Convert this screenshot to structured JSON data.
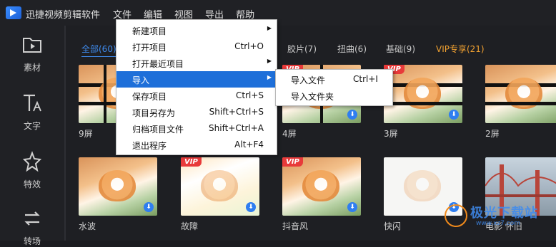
{
  "app": {
    "title": "迅捷视频剪辑软件"
  },
  "menubar": [
    "文件",
    "编辑",
    "视图",
    "导出",
    "帮助"
  ],
  "sidebar": [
    {
      "icon": "folder-icon",
      "label": "素材"
    },
    {
      "icon": "text-icon",
      "label": "文字"
    },
    {
      "icon": "sparkle-icon",
      "label": "特效"
    },
    {
      "icon": "transition-icon",
      "label": "转场"
    }
  ],
  "tabs": [
    {
      "label": "全部(60)",
      "active": true
    },
    {
      "label": "胶片(7)"
    },
    {
      "label": "扭曲(6)"
    },
    {
      "label": "基础(9)"
    },
    {
      "label": "VIP专享(21)",
      "vip": true
    }
  ],
  "file_menu": [
    {
      "label": "新建项目",
      "submenu": true
    },
    {
      "label": "打开项目",
      "shortcut": "Ctrl+O"
    },
    {
      "label": "打开最近项目",
      "submenu": true
    },
    {
      "label": "导入",
      "submenu": true,
      "highlighted": true
    },
    {
      "label": "保存项目",
      "shortcut": "Ctrl+S"
    },
    {
      "label": "项目另存为",
      "shortcut": "Shift+Ctrl+S"
    },
    {
      "label": "归档项目文件",
      "shortcut": "Shift+Ctrl+A"
    },
    {
      "label": "退出程序",
      "shortcut": "Alt+F4"
    }
  ],
  "import_submenu": [
    {
      "label": "导入文件",
      "shortcut": "Ctrl+I"
    },
    {
      "label": "导入文件夹"
    }
  ],
  "effects": [
    {
      "label": "9屏",
      "vip": false,
      "download": false
    },
    {
      "label": "",
      "vip": false,
      "download": false
    },
    {
      "label": "4屏",
      "vip": true,
      "download": true,
      "vip_text": "VIP"
    },
    {
      "label": "3屏",
      "vip": true,
      "download": true,
      "vip_text": "VIP"
    },
    {
      "label": "2屏",
      "vip": false,
      "download": false
    },
    {
      "label": "水波",
      "vip": false,
      "download": true
    },
    {
      "label": "故障",
      "vip": true,
      "download": true,
      "vip_text": "VIP"
    },
    {
      "label": "抖音风",
      "vip": true,
      "download": true,
      "vip_text": "VIP"
    },
    {
      "label": "快闪",
      "vip": false,
      "download": true
    },
    {
      "label": "电影 怀旧",
      "vip": false,
      "download": false
    }
  ],
  "watermark": {
    "text": "极光下载站",
    "sub": "www.xz7.com"
  },
  "colors": {
    "accent": "#3f8cf0",
    "vip": "#f0a030",
    "menu_highlight": "#1e6fd9",
    "badge": "#e83a3a"
  }
}
